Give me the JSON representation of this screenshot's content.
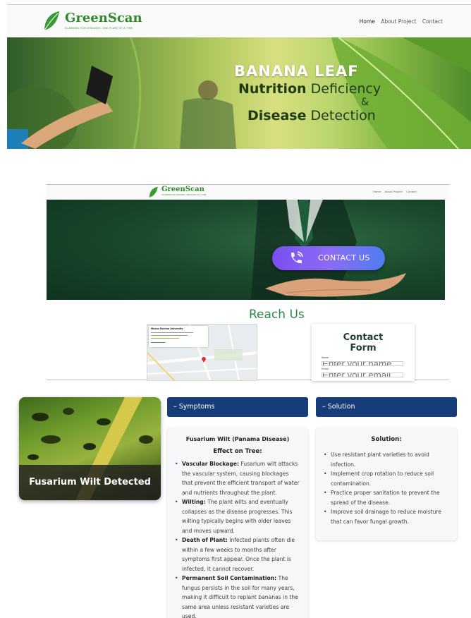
{
  "hero": {
    "brand": "GreenScan",
    "tagline": "SCANNING FOR DISEASES, ONE PLANT AT A TIME",
    "nav": [
      "Home",
      "About Project",
      "Contact"
    ],
    "banner_line1": "BANANA LEAF",
    "banner_line2_bold": "Nutrition",
    "banner_line2_rest": "Deficiency",
    "banner_amp": "&",
    "banner_line4_bold": "Disease",
    "banner_line4_rest": "Detection"
  },
  "contact": {
    "brand": "GreenScan",
    "tagline": "SCANNING FOR DISEASES, ONE PLANT AT A TIME",
    "nav": [
      "Home",
      "About Project",
      "Contact"
    ],
    "button_label": "CONTACT US",
    "reach_title": "Reach Us",
    "map_title": "Manav Rachna University",
    "form_title_line1": "Contact",
    "form_title_line2": "Form",
    "form_fields": [
      {
        "label": "Name",
        "placeholder": "Enter your name"
      },
      {
        "label": "Email",
        "placeholder": "Enter your email"
      }
    ]
  },
  "result": {
    "detected_label": "Fusarium Wilt Detected",
    "symptoms_tab": "– Symptoms",
    "solution_tab": "– Solution",
    "disease_title": "Fusarium Wilt (Panama Disease)",
    "effect_heading": "Effect on Tree:",
    "effects": [
      {
        "term": "Vascular Blockage:",
        "text": " Fusarium wilt attacks the vascular system, causing blockages that prevent the efficient transport of water and nutrients throughout the plant."
      },
      {
        "term": "Wilting:",
        "text": " The plant wilts and eventually collapses as the disease progresses. This wilting typically begins with older leaves and moves upward."
      },
      {
        "term": "Death of Plant:",
        "text": " Infected plants often die within a few weeks to months after symptoms first appear. Once the plant is infected, it cannot recover."
      },
      {
        "term": "Permanent Soil Contamination:",
        "text": " The fungus persists in the soil for many years, making it difficult to replant bananas in the same area unless resistant varieties are used."
      }
    ],
    "solution_heading": "Solution:",
    "solutions": [
      "Use resistant plant varieties to avoid infection.",
      "Implement crop rotation to reduce soil contamination.",
      "Practice proper sanitation to prevent the spread of the disease.",
      "Improve soil drainage to reduce moisture that can favor fungal growth."
    ],
    "colors": {
      "tab_bg": "#163d7a",
      "panel_bg": "#f6f7f9"
    }
  }
}
